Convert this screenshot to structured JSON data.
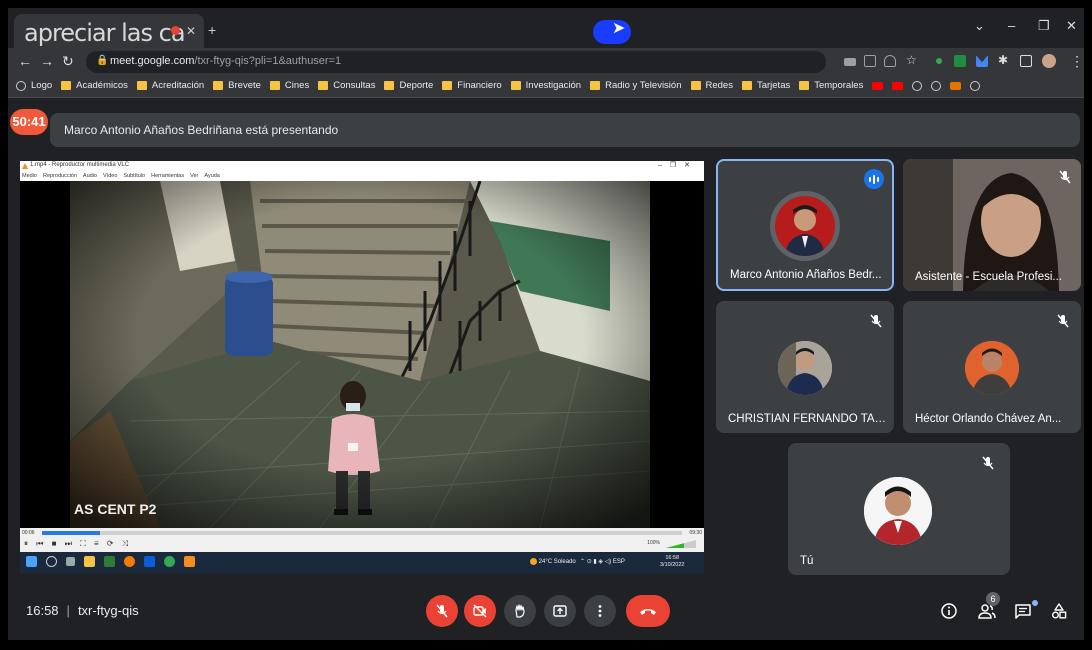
{
  "browser": {
    "tab_caption": "apreciar las ca",
    "url_host": "meet.google.com",
    "url_path": "/txr-ftyg-qis?pli=1&authuser=1",
    "bookmarks": [
      "Logo",
      "Académicos",
      "Acreditación",
      "Brevete",
      "Cines",
      "Consultas",
      "Deporte",
      "Financiero",
      "Investigación",
      "Radio y Televisión",
      "Redes",
      "Tarjetas",
      "Temporales"
    ]
  },
  "meet": {
    "timer": "50:41",
    "presenting_banner": "Marco Antonio Añaños Bedriñana está presentando",
    "time": "16:58",
    "meeting_code": "txr-ftyg-qis",
    "participant_count": "6"
  },
  "shared_screen": {
    "vlc_title": "1.mp4 - Reproductor multimedia VLC",
    "vlc_menu": [
      "Medio",
      "Reproducción",
      "Audio",
      "Vídeo",
      "Subtítulo",
      "Herramientas",
      "Ver",
      "Ayuda"
    ],
    "vlc_elapsed": "00:06",
    "vlc_total": "09:30",
    "vlc_volume": "100%",
    "playback_progress": 0.09,
    "camera_label": "AS CENT P2",
    "weather": "24°C Soleado",
    "lang": "ESP",
    "clock_time": "16:58",
    "clock_date": "3/10/2022"
  },
  "participants": [
    {
      "name": "Marco Antonio Añaños Bedr...",
      "speaking": true,
      "muted": false
    },
    {
      "name": "Asistente - Escuela Profesi...",
      "muted": true
    },
    {
      "name": "CHRISTIAN FERNANDO TAN...",
      "muted": true
    },
    {
      "name": "Héctor Orlando Chávez An...",
      "muted": true
    },
    {
      "name": "Tú",
      "muted": true
    }
  ],
  "colors": {
    "meet_bg": "#202124",
    "tile_bg": "#3c4043",
    "danger_red": "#ea4335",
    "active_blue": "#1a73e8",
    "timer_orange": "#f05a3b"
  }
}
